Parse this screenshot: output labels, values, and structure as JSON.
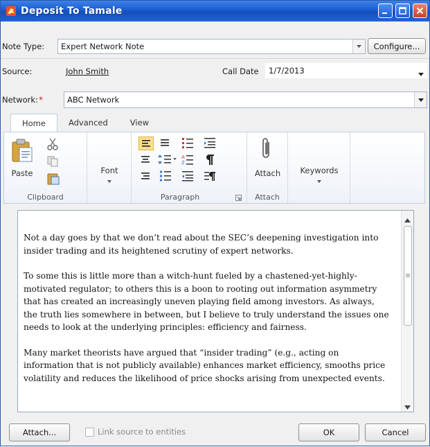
{
  "window": {
    "title": "Deposit To Tamale",
    "accent_color": "#1a5bd0"
  },
  "note_type": {
    "label": "Note Type:",
    "value": "Expert Network Note",
    "configure_label": "Configure..."
  },
  "source": {
    "label": "Source:",
    "value": "John Smith",
    "call_date_label": "Call Date",
    "call_date_value": "1/7/2013"
  },
  "network": {
    "label": "Network:",
    "required_mark": "*",
    "value": "ABC Network"
  },
  "ribbon": {
    "tabs": [
      "Home",
      "Advanced",
      "View"
    ],
    "active_tab": "Home",
    "groups": {
      "clipboard": {
        "name": "Clipboard",
        "paste_label": "Paste"
      },
      "font": {
        "label": "Font"
      },
      "paragraph": {
        "name": "Paragraph"
      },
      "attach": {
        "name": "Attach",
        "attach_label": "Attach"
      },
      "keywords": {
        "label": "Keywords"
      }
    }
  },
  "editor": {
    "paragraphs": [
      " Not a day goes by that we don’t read about the SEC’s deepening investigation into insider trading and its heightened scrutiny of expert networks.",
      "To some this is little more than a witch-hunt fueled by a chastened-yet-highly-motivated regulator; to others this is a boon to rooting out information asymmetry that has created an increasingly uneven playing field among investors. As always, the truth lies somewhere in between, but I believe to truly understand the issues one needs to look at the underlying principles: efficiency and fairness.",
      "Many market theorists have argued that “insider trading” (e.g., acting on information that is not publicly available) enhances market efficiency, smooths price volatility and reduces the likelihood of price shocks arising from unexpected events."
    ]
  },
  "footer": {
    "attach_label": "Attach...",
    "link_source_label": "Link source to entities",
    "ok_label": "OK",
    "cancel_label": "Cancel"
  }
}
